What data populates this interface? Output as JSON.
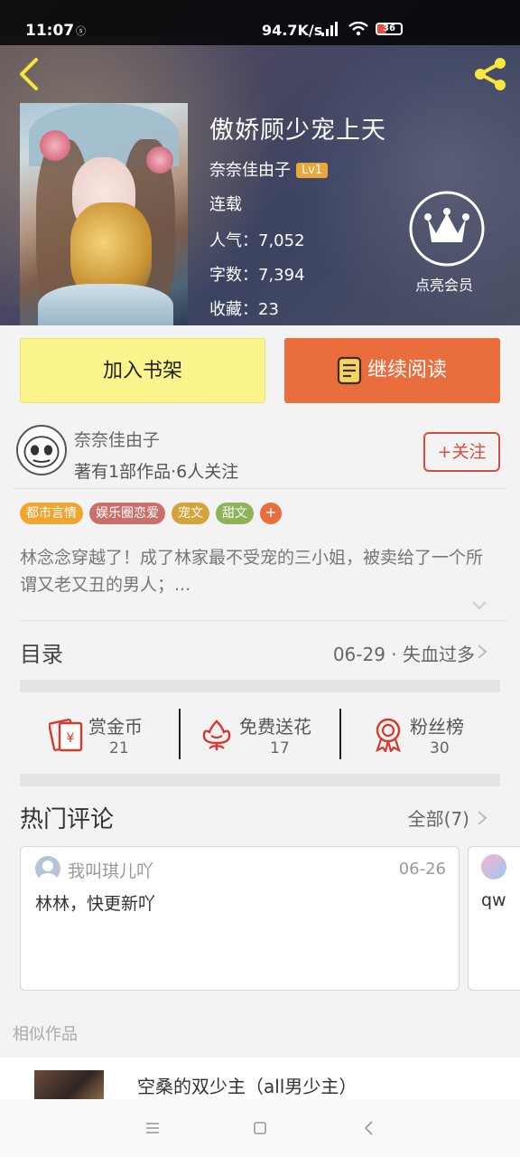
{
  "status_bar": {
    "time": "11:07",
    "net_speed": "94.7K/s",
    "battery": "36"
  },
  "book": {
    "title": "傲娇顾少宠上天",
    "author": "奈奈佳由子",
    "level": "Lv1",
    "status": "连载",
    "popularity": "人气：7,052",
    "words": "字数：7,394",
    "favorites": "收藏：23"
  },
  "vip": {
    "label": "点亮会员"
  },
  "actions": {
    "add_shelf": "加入书架",
    "continue_read": "继续阅读"
  },
  "author_card": {
    "name": "奈奈佳由子",
    "stats": "著有1部作品·6人关注",
    "follow": "+关注"
  },
  "tags": [
    {
      "label": "都市言情",
      "color": "#f0a531"
    },
    {
      "label": "娱乐圈恋爱",
      "color": "#c9706a"
    },
    {
      "label": "宠文",
      "color": "#d4a33a"
    },
    {
      "label": "甜文",
      "color": "#8fb35b"
    }
  ],
  "tags_more": "+",
  "synopsis": "林念念穿越了！成了林家最不受宠的三小姐，被卖给了一个所谓又老又丑的男人；...",
  "catalog": {
    "label": "目录",
    "latest": "06-29 · 失血过多"
  },
  "stats": [
    {
      "label": "赏金币",
      "value": "21",
      "icon": "red-envelope-icon"
    },
    {
      "label": "免费送花",
      "value": "17",
      "icon": "flower-icon"
    },
    {
      "label": "粉丝榜",
      "value": "30",
      "icon": "medal-icon"
    }
  ],
  "comments": {
    "title": "热门评论",
    "all": "全部(7)",
    "items": [
      {
        "user": "我叫琪儿吖",
        "date": "06-26",
        "text": "林林，快更新吖"
      },
      {
        "user": "",
        "date": "",
        "text": "qw"
      }
    ]
  },
  "similar": {
    "label": "相似作品",
    "items": [
      {
        "title": "空桑的双少主（all男少主）"
      }
    ]
  },
  "colors": {
    "accent_orange": "#ea6d3e",
    "shelf_yellow": "#fcf58d",
    "follow_red": "#d94c3d",
    "icon_yellow": "#f6e63d"
  }
}
